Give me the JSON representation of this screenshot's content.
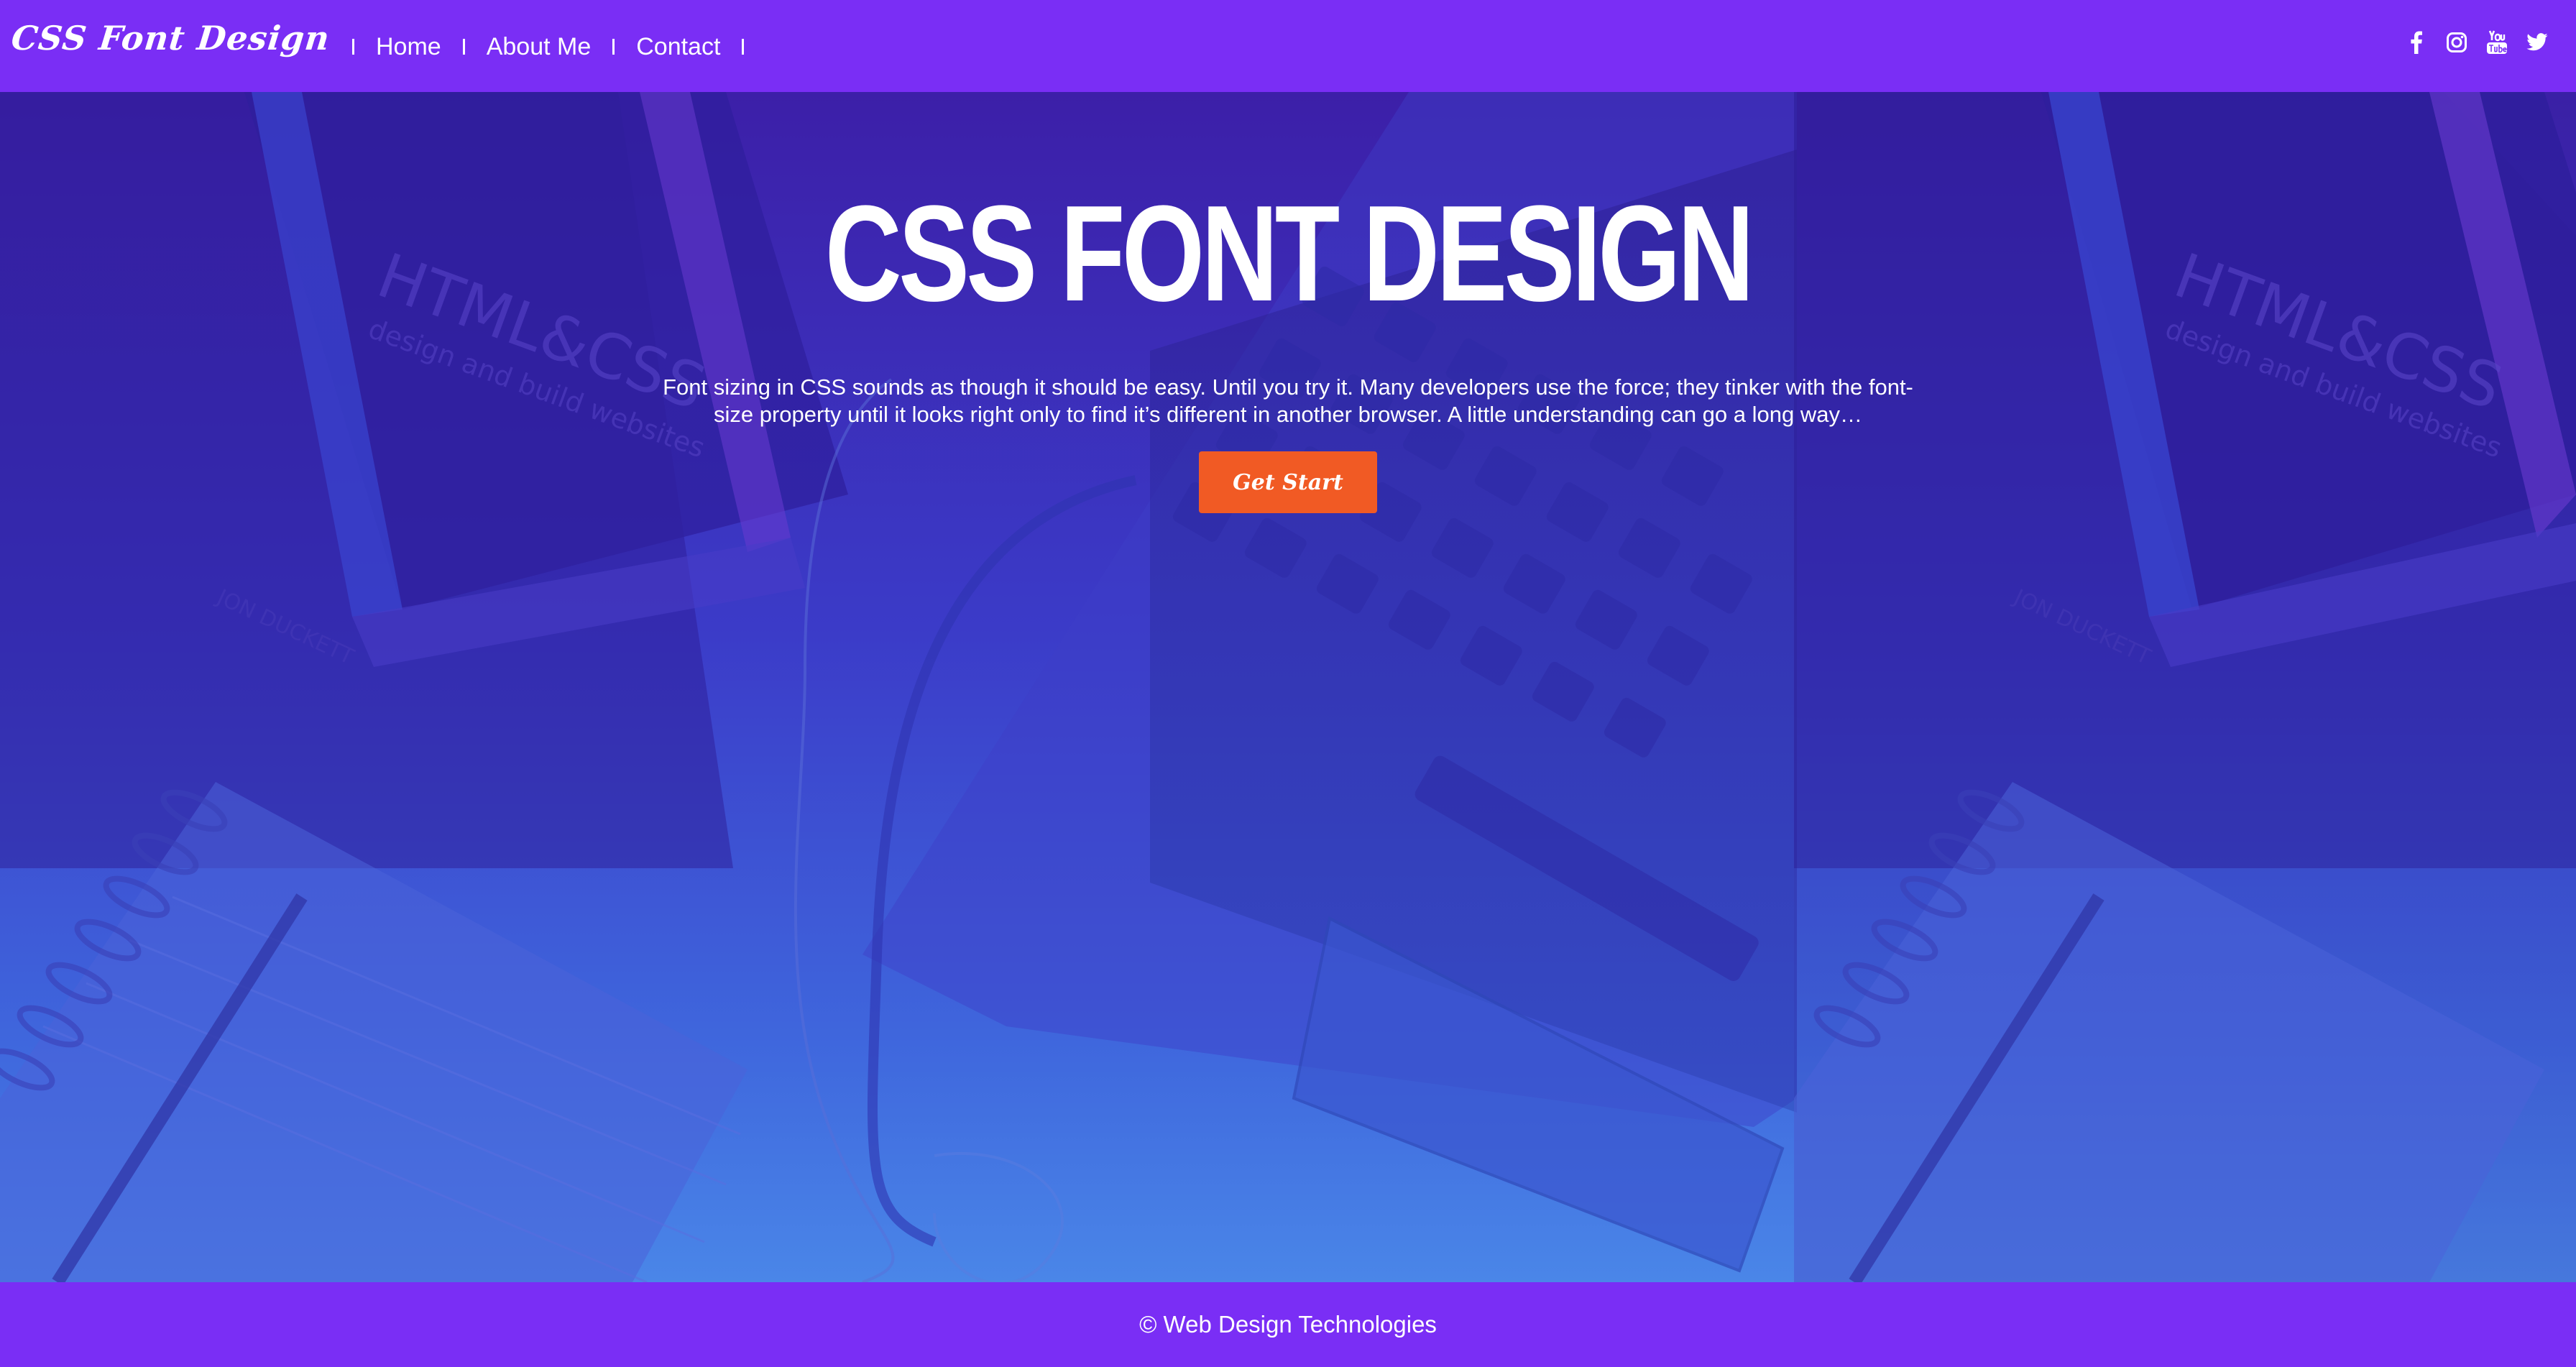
{
  "header": {
    "logo": "CSS Font Design",
    "nav": [
      {
        "label": "Home"
      },
      {
        "label": "About Me"
      },
      {
        "label": "Contact"
      }
    ],
    "social_icons": [
      "facebook-icon",
      "instagram-icon",
      "youtube-icon",
      "twitter-icon"
    ]
  },
  "hero": {
    "title": "CSS FONT DESIGN",
    "text": "Font sizing in CSS sounds as though it should be easy. Until you try it. Many developers use the force; they tinker with the font-size property until it looks right only to find it’s different in another browser. A little understanding can go a long way…",
    "cta_label": "Get Start",
    "background_image_text": {
      "book_title": "HTML&CSS",
      "book_subtitle": "design and build websites",
      "book_author": "JON DUCKETT"
    }
  },
  "footer": {
    "text": "© Web Design Technologies"
  },
  "colors": {
    "bar": "#7a2ef5",
    "button": "#f15a24",
    "overlay_top": "#3c1fa8",
    "overlay_bottom": "#4a86e8"
  }
}
